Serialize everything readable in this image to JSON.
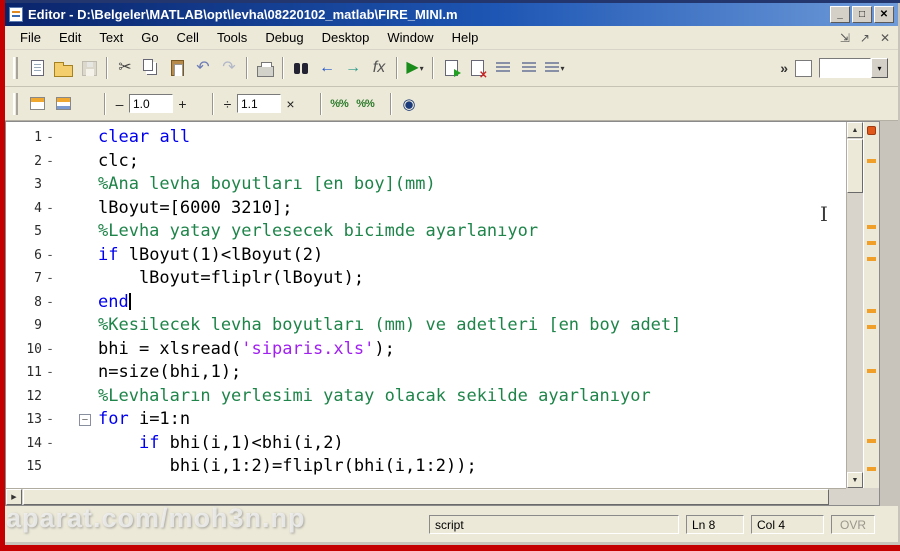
{
  "window": {
    "title": "Editor - D:\\Belgeler\\MATLAB\\opt\\levha\\08220102_matlab\\FIRE_MINl.m",
    "buttons": {
      "minimize": "_",
      "maximize": "□",
      "close": "✕"
    }
  },
  "menu": {
    "items": [
      "File",
      "Edit",
      "Text",
      "Go",
      "Cell",
      "Tools",
      "Debug",
      "Desktop",
      "Window",
      "Help"
    ],
    "right_icons": [
      {
        "name": "dock-icon",
        "glyph": "⇲"
      },
      {
        "name": "undock-icon",
        "glyph": "↗"
      },
      {
        "name": "close-pane-icon",
        "glyph": "✕"
      }
    ]
  },
  "toolbar": {
    "overflow": "»",
    "icons": [
      {
        "name": "new-file-button",
        "shape": "page"
      },
      {
        "name": "open-file-button",
        "shape": "folder"
      },
      {
        "name": "save-button",
        "shape": "floppy",
        "disabled": true
      },
      {
        "sep": true
      },
      {
        "name": "cut-button",
        "glyph": "✂",
        "color": "#444"
      },
      {
        "name": "copy-button",
        "shape": "copy"
      },
      {
        "name": "paste-button",
        "shape": "paste"
      },
      {
        "name": "undo-button",
        "glyph": "↶",
        "color": "#6b7bb5"
      },
      {
        "name": "redo-button",
        "glyph": "↷",
        "color": "#6b7bb5",
        "disabled": true
      },
      {
        "sep": true
      },
      {
        "name": "print-button",
        "shape": "printer"
      },
      {
        "sep": true
      },
      {
        "name": "find-button",
        "shape": "binoculars"
      },
      {
        "name": "back-button",
        "glyph": "←",
        "color": "#2255cc",
        "bold": true
      },
      {
        "name": "forward-button",
        "glyph": "→",
        "color": "#2a9a8a",
        "bold": true
      },
      {
        "name": "function-browser-button",
        "glyph": "fx",
        "color": "#555",
        "italic": true
      },
      {
        "sep": true
      },
      {
        "name": "run-button",
        "glyph": "▶",
        "color": "#1a8c1a",
        "dropdown": true
      },
      {
        "sep": true
      },
      {
        "name": "publish-button",
        "shape": "page-green"
      },
      {
        "name": "close-file-button",
        "shape": "page-red"
      },
      {
        "name": "comment-button",
        "shape": "lines"
      },
      {
        "name": "uncomment-button",
        "shape": "lines"
      },
      {
        "name": "smart-indent-button",
        "shape": "lines",
        "dropdown": true
      }
    ]
  },
  "cell_toolbar": {
    "minus": "–",
    "plus": "+",
    "divide": "÷",
    "multiply": "×",
    "field1": "1.0",
    "field2": "1.1",
    "eval_glyph": "%%",
    "publish_glyph": "◉"
  },
  "editor": {
    "lines": [
      {
        "n": "1",
        "d": true,
        "s": [
          {
            "t": "clear",
            "c": "kw"
          },
          {
            "t": " ",
            "c": "pl"
          },
          {
            "t": "all",
            "c": "kw"
          }
        ]
      },
      {
        "n": "2",
        "d": true,
        "s": [
          {
            "t": "clc;",
            "c": "pl"
          }
        ]
      },
      {
        "n": "3",
        "d": false,
        "s": [
          {
            "t": "%Ana levha boyutları [en boy](mm)",
            "c": "cm"
          }
        ]
      },
      {
        "n": "4",
        "d": true,
        "s": [
          {
            "t": "lBoyut=[6000 3210];",
            "c": "pl"
          }
        ]
      },
      {
        "n": "5",
        "d": false,
        "s": [
          {
            "t": "%Levha yatay yerlesecek bicimde ayarlanıyor",
            "c": "cm"
          }
        ]
      },
      {
        "n": "6",
        "d": true,
        "s": [
          {
            "t": "if",
            "c": "kw"
          },
          {
            "t": " lBoyut(1)<lBoyut(2)",
            "c": "pl"
          }
        ]
      },
      {
        "n": "7",
        "d": true,
        "s": [
          {
            "t": "    lBoyut=fliplr(lBoyut);",
            "c": "pl"
          }
        ]
      },
      {
        "n": "8",
        "d": true,
        "caret": true,
        "s": [
          {
            "t": "end",
            "c": "kw"
          }
        ]
      },
      {
        "n": "9",
        "d": false,
        "s": [
          {
            "t": "%Kesilecek levha boyutları (mm) ve adetleri [en boy adet]",
            "c": "cm"
          }
        ]
      },
      {
        "n": "10",
        "d": true,
        "s": [
          {
            "t": "bhi = xlsread(",
            "c": "pl"
          },
          {
            "t": "'siparis.xls'",
            "c": "st"
          },
          {
            "t": ");",
            "c": "pl"
          }
        ]
      },
      {
        "n": "11",
        "d": true,
        "s": [
          {
            "t": "n=size(bhi,1);",
            "c": "pl"
          }
        ]
      },
      {
        "n": "12",
        "d": false,
        "s": [
          {
            "t": "%Levhaların yerlesimi yatay olacak sekilde ayarlanıyor",
            "c": "cm"
          }
        ]
      },
      {
        "n": "13",
        "d": true,
        "fold": true,
        "s": [
          {
            "t": "for",
            "c": "kw"
          },
          {
            "t": " i=1:n",
            "c": "pl"
          }
        ]
      },
      {
        "n": "14",
        "d": true,
        "s": [
          {
            "t": "    ",
            "c": "pl"
          },
          {
            "t": "if",
            "c": "kw"
          },
          {
            "t": " bhi(i,1)<bhi(i,2)",
            "c": "pl"
          }
        ]
      },
      {
        "n": "15",
        "d": false,
        "s": [
          {
            "t": "       bhi(i,1:2)=fliplr(bhi(i,1:2));",
            "c": "pl"
          }
        ]
      }
    ],
    "fold_minus": "–",
    "markers": [
      37,
      103,
      119,
      135,
      187,
      203,
      247,
      317,
      345
    ]
  },
  "scrollbar": {
    "up": "▲",
    "down": "▼",
    "left": "◀",
    "right": "▶",
    "combo_arrow": "▾"
  },
  "status": {
    "mode": "script",
    "ln": "Ln 8",
    "col": "Col 4",
    "ovr": "OVR"
  },
  "watermark": "aparat.com/moh3n.np",
  "cursor_glyph": "I"
}
